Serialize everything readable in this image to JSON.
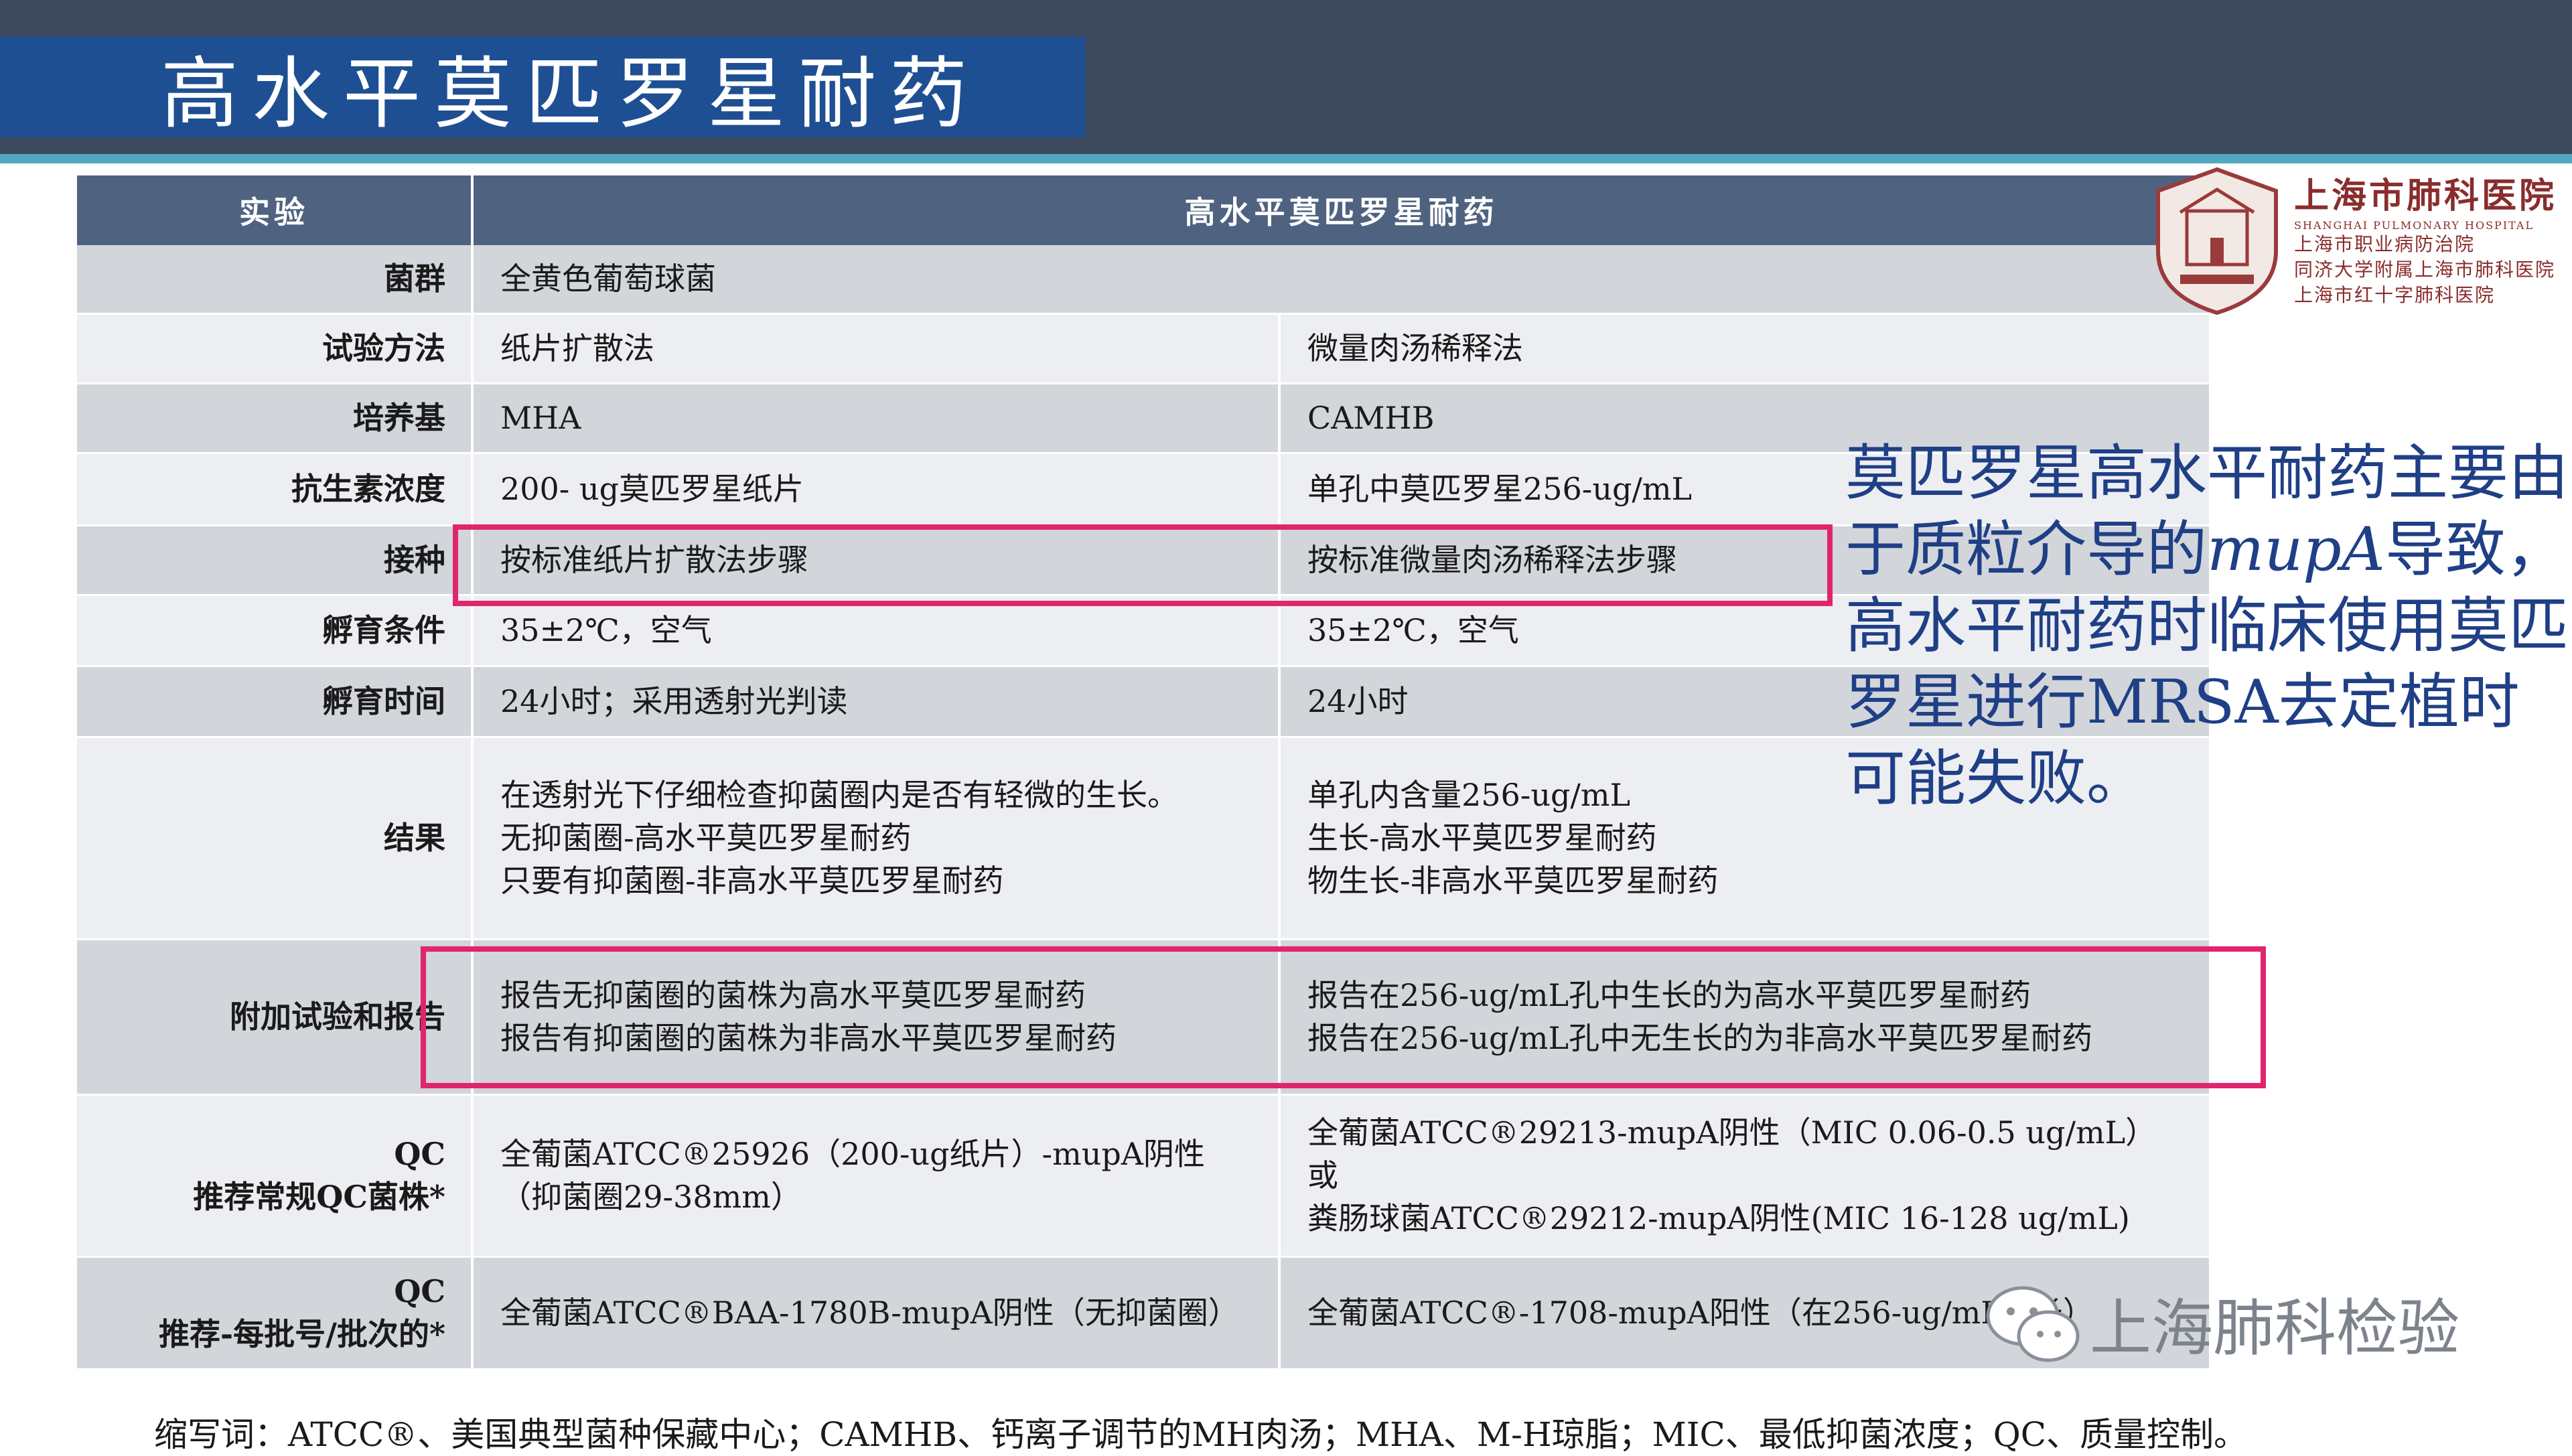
{
  "title": "高水平莫匹罗星耐药",
  "table": {
    "header": [
      "实验",
      "高水平莫匹罗星耐药"
    ],
    "rows": [
      {
        "label": "菌群",
        "span": true,
        "col1": "全黄色葡萄球菌",
        "col2": "",
        "shade": "dark"
      },
      {
        "label": "试验方法",
        "col1": "纸片扩散法",
        "col2": "微量肉汤稀释法",
        "shade": "light"
      },
      {
        "label": "培养基",
        "col1": "MHA",
        "col2": "CAMHB",
        "shade": "dark"
      },
      {
        "label": "抗生素浓度",
        "col1": "200- ug莫匹罗星纸片",
        "col2": "单孔中莫匹罗星256-ug/mL",
        "shade": "light"
      },
      {
        "label": "接种",
        "col1": "按标准纸片扩散法步骤",
        "col2": "按标准微量肉汤稀释法步骤",
        "shade": "dark"
      },
      {
        "label": "孵育条件",
        "col1": "35±2℃，空气",
        "col2": "35±2℃，空气",
        "shade": "light"
      },
      {
        "label": "孵育时间",
        "col1": "24小时；采用透射光判读",
        "col2": "24小时",
        "shade": "dark"
      },
      {
        "label": "结果",
        "col1_lines": [
          "在透射光下仔细检查抑菌圈内是否有轻微的生长。",
          "无抑菌圈-高水平莫匹罗星耐药",
          "只要有抑菌圈-非高水平莫匹罗星耐药"
        ],
        "col2_lines": [
          "单孔内含量256-ug/mL",
          "生长-高水平莫匹罗星耐药",
          "物生长-非高水平莫匹罗星耐药"
        ],
        "shade": "light"
      },
      {
        "label": "附加试验和报告",
        "col1_lines": [
          "报告无抑菌圈的菌株为高水平莫匹罗星耐药",
          "报告有抑菌圈的菌株为非高水平莫匹罗星耐药"
        ],
        "col2_lines": [
          "报告在256-ug/mL孔中生长的为高水平莫匹罗星耐药",
          "报告在256-ug/mL孔中无生长的为非高水平莫匹罗星耐药"
        ],
        "shade": "dark"
      },
      {
        "label_lines": [
          "QC",
          "推荐常规QC菌株*"
        ],
        "col1_lines": [
          "全葡菌ATCC®25926（200-ug纸片）-mupA阴性",
          "（抑菌圈29-38mm）"
        ],
        "col2_lines": [
          "全葡菌ATCC®29213-mupA阴性（MIC 0.06-0.5 ug/mL）",
          "或",
          "粪肠球菌ATCC®29212-mupA阴性(MIC 16-128 ug/mL)"
        ],
        "shade": "light"
      },
      {
        "label_lines": [
          "QC",
          "推荐-每批号/批次的*"
        ],
        "col1": "全葡菌ATCC®BAA-1780B-mupA阴性（无抑菌圈）",
        "col2": "全葡菌ATCC®-1708-mupA阳性（在256-ug/mL生长）",
        "shade": "dark"
      }
    ]
  },
  "note": {
    "part1": "莫匹罗星高水平耐药主要由于质粒介导的",
    "gene": "mupA",
    "part2": "导致，高水平耐药时临床使用莫匹罗星进行MRSA去定植时可能失败。"
  },
  "logo": {
    "name": "上海市肺科医院",
    "english": "SHANGHAI PULMONARY HOSPITAL",
    "sub": [
      "上海市职业病防治院",
      "同济大学附属上海市肺科医院",
      "上海市红十字肺科医院"
    ]
  },
  "watermark": "上海肺科检验",
  "footer": "缩写词：ATCC®、美国典型菌种保藏中心；CAMHB、钙离子调节的MH肉汤；MHA、M-H琼脂；MIC、最低抑菌浓度；QC、质量控制。",
  "colors": {
    "topbar": "#3d4a5e",
    "title_box": "#1f4f93",
    "accent": "#53a8bf",
    "header": "#4f6280",
    "row_dark": "#d2d5da",
    "row_light": "#eceef1",
    "highlight": "#e0256e",
    "note_text": "#1f3f86"
  }
}
